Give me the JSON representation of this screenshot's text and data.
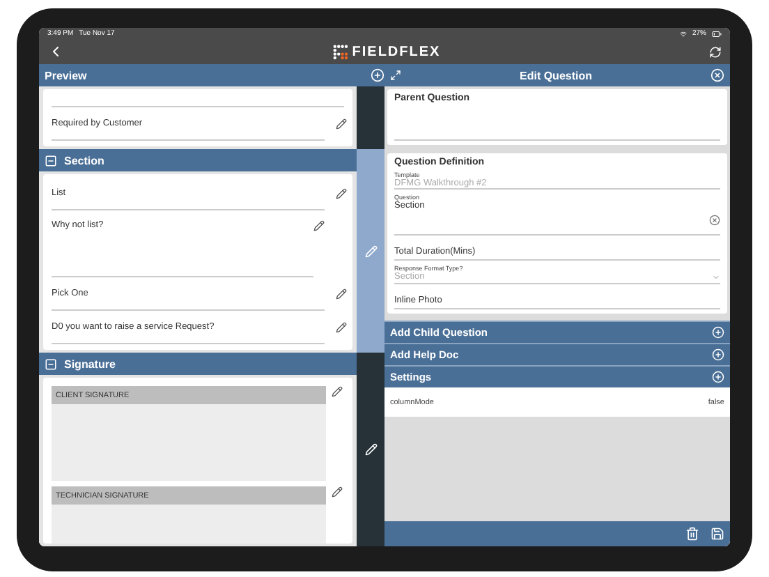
{
  "status_bar": {
    "time": "3:49 PM",
    "date": "Tue Nov 17",
    "battery": "27%"
  },
  "nav_bar": {
    "logo": "FIELDFLEX"
  },
  "preview": {
    "title": "Preview",
    "sections": [
      {
        "selected": false,
        "items": [
          {
            "kind": "field",
            "label": "Required by Customer"
          }
        ]
      },
      {
        "header": "Section",
        "expanded": true,
        "selected": true,
        "items": [
          {
            "kind": "field",
            "label": "List"
          },
          {
            "kind": "tall",
            "label": "Why not list?"
          },
          {
            "kind": "field",
            "label": "Pick One"
          },
          {
            "kind": "field",
            "label": "D0 you want to raise a service Request?"
          }
        ]
      },
      {
        "header": "Signature",
        "expanded": true,
        "selected": false,
        "items": [
          {
            "kind": "signature",
            "label": "CLIENT SIGNATURE"
          },
          {
            "kind": "signature",
            "label": "TECHNICIAN SIGNATURE"
          }
        ]
      }
    ]
  },
  "edit_panel": {
    "title": "Edit Question",
    "parent_question": "Parent Question",
    "definition": {
      "title": "Question Definition",
      "fields": [
        {
          "kind": "readonly",
          "label": "Template",
          "value": "DFMG Walkthrough #2"
        },
        {
          "kind": "text",
          "label": "Question",
          "value": "Section"
        },
        {
          "kind": "plain",
          "label": "Total Duration(Mins)"
        },
        {
          "kind": "select",
          "label": "Response Format Type?",
          "value": "Section"
        },
        {
          "kind": "plain",
          "label": "Inline Photo"
        }
      ]
    },
    "actions": [
      {
        "label": "Add Child Question"
      },
      {
        "label": "Add Help Doc"
      },
      {
        "label": "Settings"
      }
    ],
    "settings": [
      {
        "key": "columnMode",
        "value": "false"
      }
    ]
  }
}
